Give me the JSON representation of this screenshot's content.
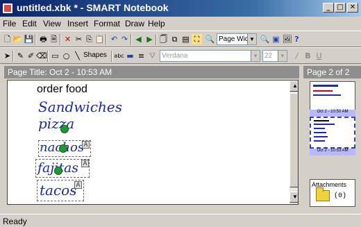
{
  "window": {
    "title": "untitled.xbk * - SMART Notebook",
    "min": "_",
    "max": "□",
    "close": "✕"
  },
  "menu": [
    "File",
    "Edit",
    "View",
    "Insert",
    "Format",
    "Draw",
    "Help"
  ],
  "toolbar1": {
    "icons": [
      "new-icon",
      "open-icon",
      "save-icon",
      "print-icon",
      "preview-icon",
      "delete-icon",
      "cut-icon",
      "copy-icon",
      "paste-icon",
      "undo-icon",
      "redo-icon",
      "prev-page-icon",
      "next-page-icon",
      "insert-page-icon",
      "clone-page-icon",
      "page-sort-icon",
      "screen-capture-icon",
      "zoom-icon"
    ],
    "zoom_value": "Page Wic",
    "zoom_in": "🔍",
    "side_icons": [
      "toggle-pane-icon",
      "gallery-icon",
      "help-icon"
    ]
  },
  "toolbar2": {
    "shapes_label": "Shapes",
    "font_value": "Verdana",
    "size_value": "22",
    "format": [
      "/",
      "B",
      "U"
    ]
  },
  "page": {
    "title_label": "Page Title: Oct 2 - 10:53 AM",
    "typed_text": "order food",
    "handwriting": [
      "Sandwiches",
      "pizza",
      "nachos",
      "fajitas",
      "tacos"
    ],
    "badge": "A"
  },
  "sorter": {
    "header": "Page 2 of 2",
    "thumbs": [
      {
        "label": "Oct 2 - 10:50 AM"
      },
      {
        "label": "Oct 2 - 10:53 AM"
      }
    ]
  },
  "attachments": {
    "label": "Attachments",
    "count": "(0)"
  },
  "status": "Ready",
  "colors": {
    "ink": "#1a2aa8",
    "dot": "#1f9a32",
    "titlebar": "#0a246a"
  }
}
